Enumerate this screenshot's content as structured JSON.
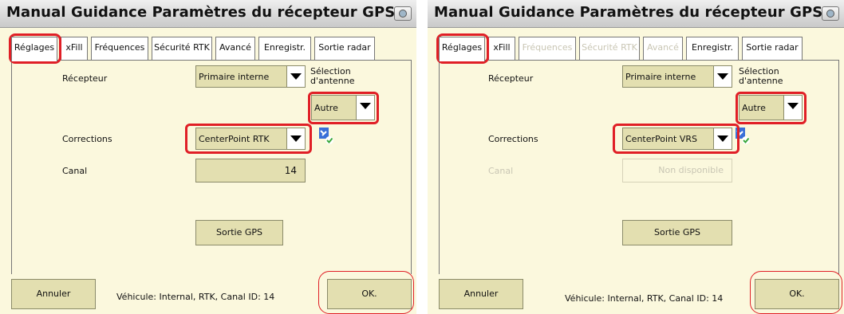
{
  "panels": [
    {
      "title": "Manual Guidance Paramètres du récepteur GPS",
      "tabs": [
        {
          "label": "Réglages",
          "disabled": false
        },
        {
          "label": "xFill",
          "disabled": false
        },
        {
          "label": "Fréquences",
          "disabled": false
        },
        {
          "label": "Sécurité RTK",
          "disabled": false
        },
        {
          "label": "Avancé",
          "disabled": false
        },
        {
          "label": "Enregistr.",
          "disabled": false
        },
        {
          "label": "Sortie radar",
          "disabled": false
        }
      ],
      "receiver_label": "Récepteur",
      "receiver_value": "Primaire interne",
      "antenna_label_line1": "Sélection",
      "antenna_label_line2": "d'antenne",
      "antenna_value": "Autre",
      "corrections_label": "Corrections",
      "corrections_value": "CenterPoint RTK",
      "channel_label": "Canal",
      "channel_value": "14",
      "gps_output_label": "Sortie GPS",
      "cancel_label": "Annuler",
      "status_text": "Véhicule: Internal, RTK, Canal ID: 14",
      "ok_label": "OK."
    },
    {
      "title": "Manual Guidance Paramètres du récepteur GPS",
      "tabs": [
        {
          "label": "Réglages",
          "disabled": false
        },
        {
          "label": "xFill",
          "disabled": false
        },
        {
          "label": "Fréquences",
          "disabled": true
        },
        {
          "label": "Sécurité RTK",
          "disabled": true
        },
        {
          "label": "Avancé",
          "disabled": true
        },
        {
          "label": "Enregistr.",
          "disabled": false
        },
        {
          "label": "Sortie radar",
          "disabled": false
        }
      ],
      "receiver_label": "Récepteur",
      "receiver_value": "Primaire interne",
      "antenna_label_line1": "Sélection",
      "antenna_label_line2": "d'antenne",
      "antenna_value": "Autre",
      "corrections_label": "Corrections",
      "corrections_value": "CenterPoint VRS",
      "channel_label": "Canal",
      "channel_value": "Non disponible",
      "gps_output_label": "Sortie GPS",
      "cancel_label": "Annuler",
      "status_text": "Véhicule: Internal, RTK, Canal ID: 14",
      "ok_label": "OK."
    }
  ],
  "icons": {
    "camera": "camera-icon",
    "satellite": "satellite-check-icon"
  },
  "colors": {
    "background": "#fbf8dd",
    "control": "#e3dfb0",
    "highlight": "#e01f26",
    "disabled_text": "#c9c6b4"
  }
}
